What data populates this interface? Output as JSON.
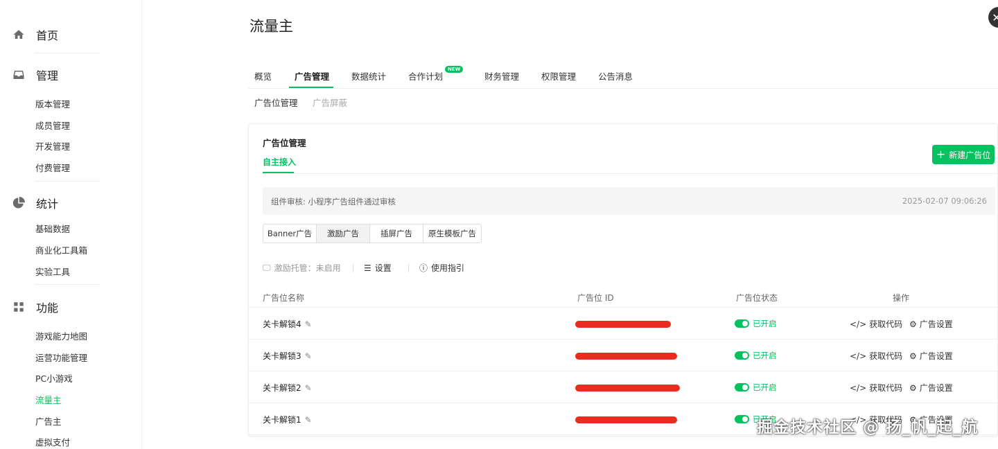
{
  "sidebar": {
    "sections": [
      {
        "label": "首页",
        "icon": "home-icon"
      },
      {
        "label": "管理",
        "icon": "inbox-icon",
        "items": [
          "版本管理",
          "成员管理",
          "开发管理",
          "付费管理"
        ]
      },
      {
        "label": "统计",
        "icon": "pie-chart-icon",
        "items": [
          "基础数据",
          "商业化工具箱",
          "实验工具"
        ]
      },
      {
        "label": "功能",
        "icon": "grid-icon",
        "items": [
          "游戏能力地图",
          "运营功能管理",
          "PC小游戏",
          "流量主",
          "广告主",
          "虚拟支付"
        ]
      }
    ],
    "active_item": "流量主"
  },
  "page": {
    "title": "流量主",
    "close_icon": "close-icon"
  },
  "tabs": [
    "概览",
    "广告管理",
    "数据统计",
    "合作计划",
    "财务管理",
    "权限管理",
    "公告消息"
  ],
  "active_tab": "广告管理",
  "new_badge": "NEW",
  "subtabs": [
    "广告位管理",
    "广告屏蔽"
  ],
  "card": {
    "title": "广告位管理",
    "tab": "自主接入",
    "new_button": "新建广告位",
    "notice": "组件审核: 小程序广告组件通过审核",
    "notice_time": "2025-02-07 09:06:26",
    "ad_types": [
      "Banner广告",
      "激励广告",
      "插屏广告",
      "原生模板广告"
    ],
    "active_ad_type": "激励广告",
    "toolbar": {
      "hosting": "激励托管：未启用",
      "settings": "设置",
      "guide": "使用指引"
    },
    "table": {
      "columns": [
        "广告位名称",
        "广告位 ID",
        "广告位状态",
        "操作"
      ],
      "rows": [
        {
          "name": "关卡解锁4",
          "status": "已开启",
          "op1": "获取代码",
          "op2": "广告设置"
        },
        {
          "name": "关卡解锁3",
          "status": "已开启",
          "op1": "获取代码",
          "op2": "广告设置"
        },
        {
          "name": "关卡解锁2",
          "status": "已开启",
          "op1": "获取代码",
          "op2": "广告设置"
        },
        {
          "name": "关卡解锁1",
          "status": "已开启",
          "op1": "获取代码",
          "op2": "广告设置"
        }
      ]
    }
  },
  "watermark": "掘金技术社区 @ 扬_帆_起_航",
  "colors": {
    "accent": "#07c160",
    "redaction": "#ea2b1f"
  }
}
